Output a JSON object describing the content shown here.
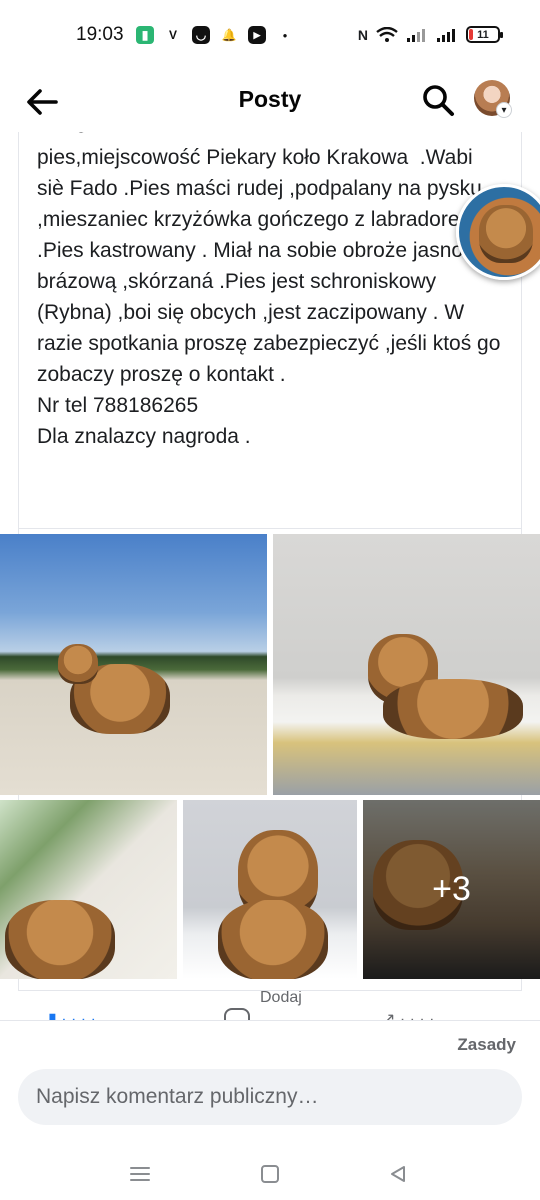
{
  "status_bar": {
    "time": "19:03",
    "battery": "11"
  },
  "app_bar": {
    "title": "Posty"
  },
  "post": {
    "top_clipped_text": "wiergo",
    "paragraphs": [
      "pies,miejscowość Piekary koło Krakowa  .Wabi siè Fado .Pies maści rudej ,podpalany na pysku ,mieszaniec krzyżówka gończego z labradorem .Pies kastrowany . Miał na sobie obroże jasno brázową ,skórzaná .Pies jest schroniskowy (Rybna) ,boi się obcych ,jest zaczipowany . W razie spotkania proszę zabezpieczyć ,jeśli ktoś go zobaczy proszę o kontakt .",
      "Nr tel 788186265",
      "Dla znalazcy nagroda ."
    ],
    "more_photos_label": "+3"
  },
  "actions": {
    "comment_label": "Dodaj"
  },
  "comment_sheet": {
    "policy_label": "Zasady",
    "input_placeholder": "Napisz komentarz publiczny…"
  },
  "colors": {
    "accent": "#1877f2",
    "muted": "#65676b",
    "input_bg": "#f0f2f5"
  }
}
